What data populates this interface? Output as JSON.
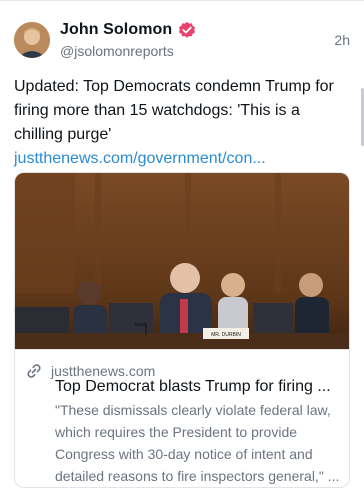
{
  "author": {
    "display_name": "John Solomon",
    "handle": "@jsolomonreports",
    "verified_color": "#e8436e",
    "avatar_icon": "person-avatar"
  },
  "post": {
    "time": "2h",
    "text": "Updated: Top Democrats condemn Trump for firing more than 15 watchdogs: 'This is a chilling purge' ",
    "link_text": "justthenews.com/government/con..."
  },
  "card": {
    "image_icon": "senate-hearing-photo",
    "nameplate": "MR. DURBIN",
    "link_icon": "link-icon",
    "domain": "justthenews.com",
    "title": "Top Democrat blasts Trump for firing ...",
    "description": "\"These dismissals clearly violate federal law, which requires the President to provide Congress with 30-day notice of intent and detailed reasons to fire inspectors general,\" ..."
  },
  "colors": {
    "link": "#2a8bd1",
    "secondary_text": "#6b7480",
    "border": "#e1e4e8"
  }
}
